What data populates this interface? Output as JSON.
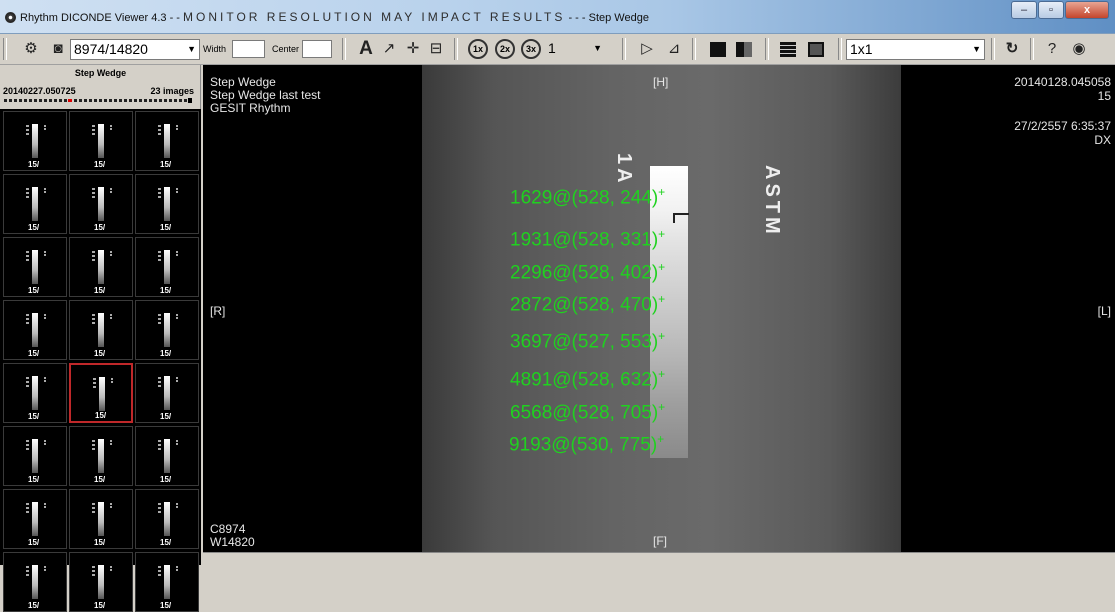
{
  "window": {
    "app_title": "Rhythm DICONDE Viewer 4.3 - -",
    "warning": "MONITOR RESOLUTION MAY IMPACT RESULTS",
    "suffix": "- - - Step Wedge",
    "minimize": "–",
    "maximize": "▫",
    "close": "x"
  },
  "toolbar": {
    "image_index": "8974/14820",
    "width_label": "Width",
    "center_label": "Center",
    "zoom_value": "1",
    "layout_value": "1x1",
    "text_tool": "A",
    "zoom_1x": "1x",
    "zoom_2x": "2x",
    "zoom_3x": "3x",
    "help": "?"
  },
  "thumbnails": {
    "series_title": "Step Wedge",
    "date": "20140227.050725",
    "count": "23 images",
    "label": "15/"
  },
  "overlay": {
    "top_left": [
      "Step Wedge",
      "Step Wedge last test",
      "GESIT Rhythm"
    ],
    "top_center": "[H]",
    "top_right_1": "20140128.045058",
    "top_right_2": "15",
    "top_right_3": "27/2/2557 6:35:37",
    "top_right_4": "DX",
    "left": "[R]",
    "right": "[L]",
    "bottom_center": "[F]",
    "bottom_left_1": "C8974",
    "bottom_left_2": "W14820",
    "plate_1a": "1A",
    "plate_astm": "ASTM"
  },
  "measurements": [
    "1629@(528, 244)",
    "1931@(528, 331)",
    "2296@(528, 402)",
    "2872@(528, 470)",
    "3697@(527, 553)",
    "4891@(528, 632)",
    "6568@(528, 705)",
    "9193@(530, 775)"
  ]
}
